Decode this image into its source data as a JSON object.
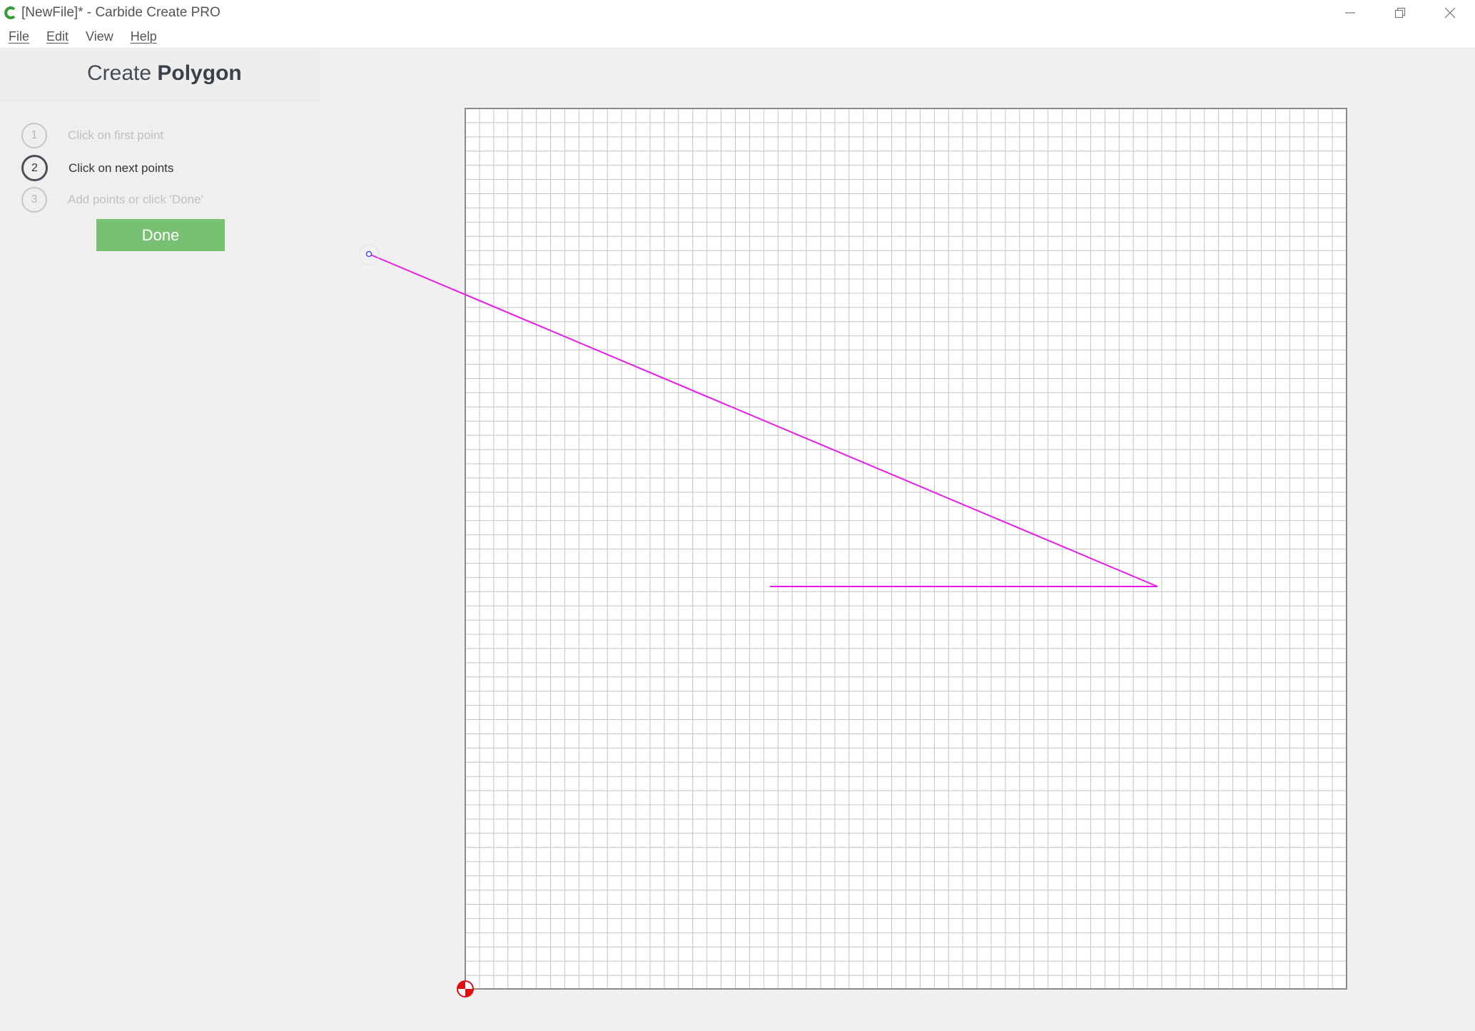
{
  "window": {
    "title": "[NewFile]* - Carbide Create PRO",
    "minimize_icon": "minimize-icon",
    "restore_icon": "restore-icon",
    "close_icon": "close-icon"
  },
  "menu": {
    "items": [
      {
        "label": "File",
        "accel": "F"
      },
      {
        "label": "Edit",
        "accel": "E"
      },
      {
        "label": "View",
        "accel": ""
      },
      {
        "label": "Help",
        "accel": "H"
      }
    ]
  },
  "panel": {
    "title_prefix": "Create",
    "title_strong": "Polygon",
    "steps": [
      {
        "number": "1",
        "label": "Click on first point",
        "state": "done"
      },
      {
        "number": "2",
        "label": "Click on next points",
        "state": "active"
      },
      {
        "number": "3",
        "label": "Add points or click 'Done'",
        "state": "pending"
      }
    ],
    "done_label": "Done",
    "done_color": "#79c172"
  },
  "canvas": {
    "grid_color": "#c4c4c4",
    "border_color": "#8a8a8a",
    "polyline_color": "#e81ce8",
    "origin_icon": "origin-target-icon",
    "origin_color": "#e01010"
  }
}
